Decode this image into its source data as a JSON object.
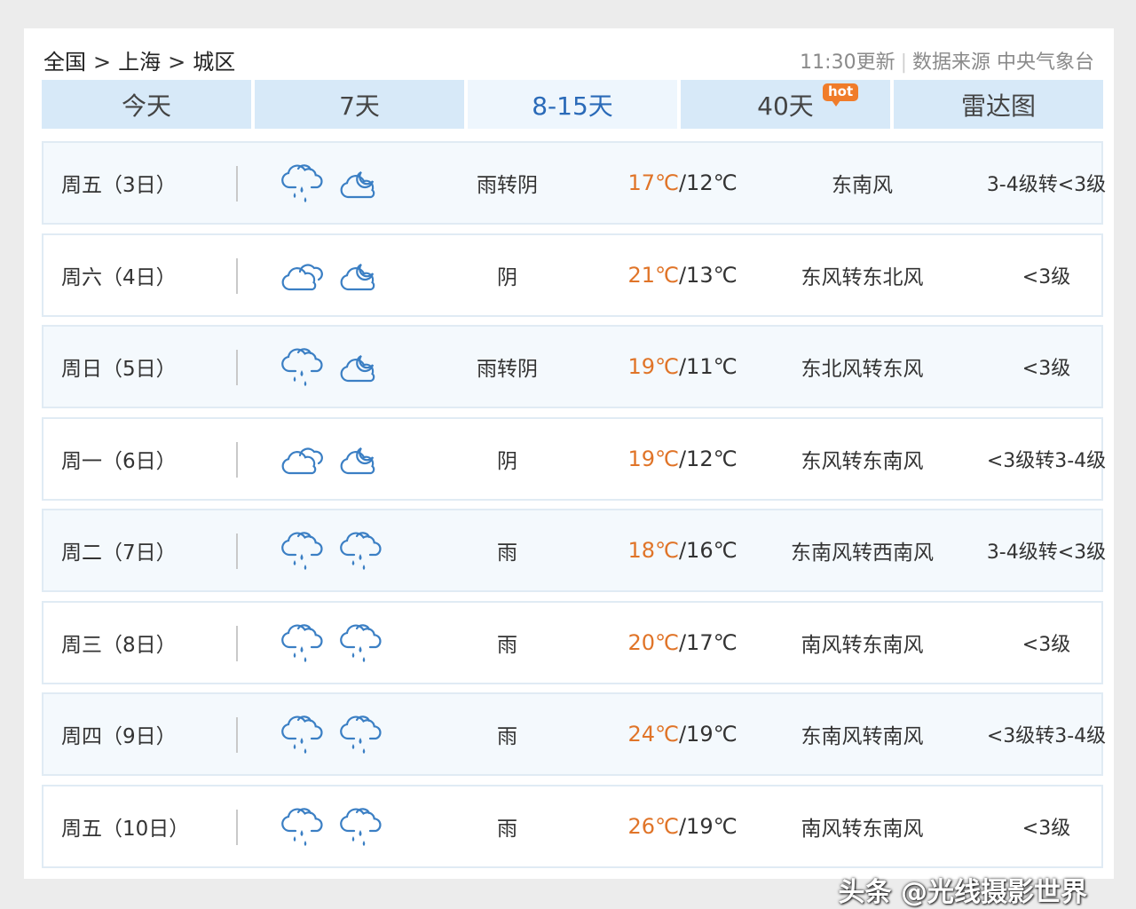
{
  "breadcrumb": {
    "country": "全国",
    "city": "上海",
    "district": "城区",
    "separator": ">"
  },
  "meta": {
    "updated": "11:30更新",
    "divider": "|",
    "source": "数据来源 中央气象台"
  },
  "tabs": [
    {
      "label": "今天"
    },
    {
      "label": "7天"
    },
    {
      "label": "8-15天"
    },
    {
      "label": "40天",
      "badge": "hot"
    },
    {
      "label": "雷达图"
    }
  ],
  "active_tab": "8-15天",
  "forecast": [
    {
      "day": "周五（3日）",
      "icon_day": "rain-cloud-icon",
      "icon_night": "cloudy-night-icon",
      "condition": "雨转阴",
      "high": "17℃",
      "low": "12℃",
      "wind": "东南风",
      "level": "3-4级转<3级"
    },
    {
      "day": "周六（4日）",
      "icon_day": "overcast-cloud-icon",
      "icon_night": "cloudy-night-icon",
      "condition": "阴",
      "high": "21℃",
      "low": "13℃",
      "wind": "东风转东北风",
      "level": "<3级"
    },
    {
      "day": "周日（5日）",
      "icon_day": "rain-cloud-icon",
      "icon_night": "cloudy-night-icon",
      "condition": "雨转阴",
      "high": "19℃",
      "low": "11℃",
      "wind": "东北风转东风",
      "level": "<3级"
    },
    {
      "day": "周一（6日）",
      "icon_day": "overcast-cloud-icon",
      "icon_night": "cloudy-night-icon",
      "condition": "阴",
      "high": "19℃",
      "low": "12℃",
      "wind": "东风转东南风",
      "level": "<3级转3-4级"
    },
    {
      "day": "周二（7日）",
      "icon_day": "rain-cloud-icon",
      "icon_night": "rain-cloud-icon",
      "condition": "雨",
      "high": "18℃",
      "low": "16℃",
      "wind": "东南风转西南风",
      "level": "3-4级转<3级"
    },
    {
      "day": "周三（8日）",
      "icon_day": "rain-cloud-icon",
      "icon_night": "rain-cloud-icon",
      "condition": "雨",
      "high": "20℃",
      "low": "17℃",
      "wind": "南风转东南风",
      "level": "<3级"
    },
    {
      "day": "周四（9日）",
      "icon_day": "rain-cloud-icon",
      "icon_night": "rain-cloud-icon",
      "condition": "雨",
      "high": "24℃",
      "low": "19℃",
      "wind": "东南风转南风",
      "level": "<3级转3-4级"
    },
    {
      "day": "周五（10日）",
      "icon_day": "rain-cloud-icon",
      "icon_night": "rain-cloud-icon",
      "condition": "雨",
      "high": "26℃",
      "low": "19℃",
      "wind": "南风转东南风",
      "level": "<3级"
    }
  ],
  "watermark": "头条 @光线摄影世界",
  "colors": {
    "tab_bg": "#d7e9f8",
    "tab_active_text": "#2a6ab8",
    "high_temp": "#e07428",
    "hot_badge": "#f07c2a",
    "icon_stroke": "#3b7fc4"
  }
}
